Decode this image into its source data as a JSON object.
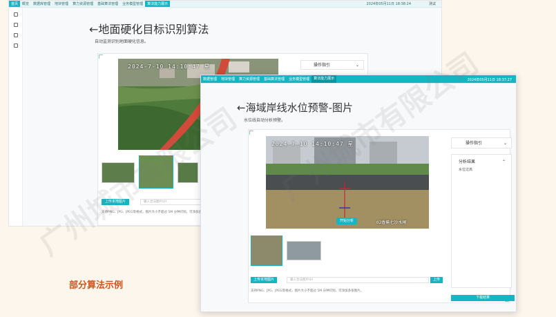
{
  "window1": {
    "nav": [
      "首页",
      "概览",
      "数据库管理",
      "地块管理",
      "算力资源管理",
      "基础算法管理",
      "业务模型管理",
      "算法能力展示"
    ],
    "active_nav": "算法能力展示",
    "datetime": "2024年05月11日 18:38:24",
    "user": "测试",
    "title": "地面硬化目标识别算法",
    "subtitle": "自动监测识别地面硬化信息。",
    "overlay_text": "2024-7-10  14:10:47 星",
    "panel_label": "操作指引",
    "upload_label": "上传本地图片",
    "input_placeholder": "输入合法图片Url",
    "note": "支持PNG、JPG、JPEG等格式，图片大小不超过 5M 分钟识别，可添加多张图片..."
  },
  "window2": {
    "nav": [
      "数据管理",
      "地块管理",
      "算力资源管理",
      "基础算法管理",
      "业务模型管理",
      "算法能力展示"
    ],
    "active_nav": "算法能力展示",
    "datetime": "2024年05月11日 18:37:27",
    "title": "海域岸线水位预警-图片",
    "subtitle": "水位线自动分析预警。",
    "overlay_date": "2024-7-10  14:10:47 星",
    "camera_label": "02香蕉七沙水闸",
    "center_button": "开始分析",
    "panel_guide": "操作指引",
    "panel_result": "分析结果",
    "result_value": "水位过高",
    "upload_label": "上传本地图片",
    "input_placeholder": "输入合法图片Url",
    "url_button": "上传",
    "note": "支持PNG、JPG、JPEG等格式，图片大小不超过 5M 分钟识别，可添加多张图片。",
    "download_button": "下载结果"
  },
  "caption": "部分算法示例",
  "watermark": "广州城市有限公司",
  "colors": {
    "accent": "#14b6c2",
    "caption": "#d2541b"
  }
}
